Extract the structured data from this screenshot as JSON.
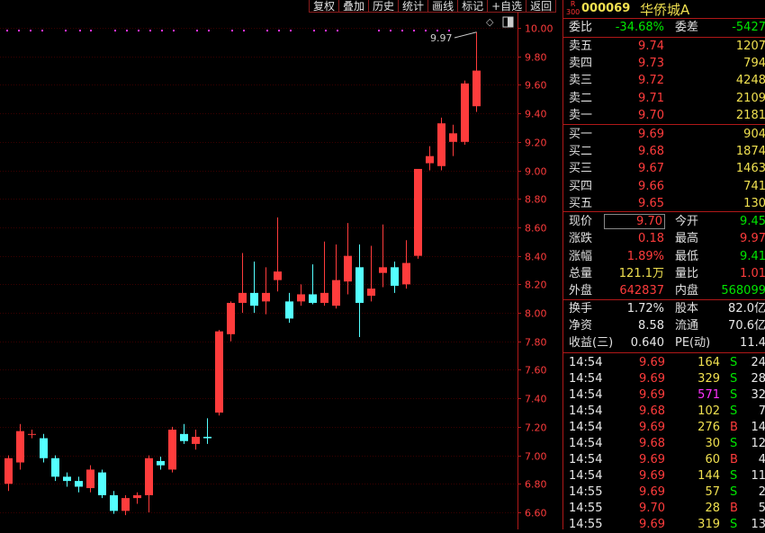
{
  "toolbar": [
    "复权",
    "叠加",
    "历史",
    "统计",
    "画线",
    "标记",
    "+自选",
    "返回"
  ],
  "header": {
    "badge_top": "R",
    "badge_bottom": "300",
    "code": "000069",
    "name": "华侨城A"
  },
  "ratio": {
    "label1": "委比",
    "value1": "-34.68%",
    "label2": "委差",
    "value2": "-5427"
  },
  "asks": [
    {
      "label": "卖五",
      "price": "9.74",
      "vol": "1207"
    },
    {
      "label": "卖四",
      "price": "9.73",
      "vol": "794"
    },
    {
      "label": "卖三",
      "price": "9.72",
      "vol": "4248"
    },
    {
      "label": "卖二",
      "price": "9.71",
      "vol": "2109"
    },
    {
      "label": "卖一",
      "price": "9.70",
      "vol": "2181"
    }
  ],
  "bids": [
    {
      "label": "买一",
      "price": "9.69",
      "vol": "904"
    },
    {
      "label": "买二",
      "price": "9.68",
      "vol": "1874"
    },
    {
      "label": "买三",
      "price": "9.67",
      "vol": "1463"
    },
    {
      "label": "买四",
      "price": "9.66",
      "vol": "741"
    },
    {
      "label": "买五",
      "price": "9.65",
      "vol": "130"
    }
  ],
  "quote": [
    {
      "l": "现价",
      "v": "9.70",
      "l2": "今开",
      "v2": "9.45"
    },
    {
      "l": "涨跌",
      "v": "0.18",
      "l2": "最高",
      "v2": "9.97"
    },
    {
      "l": "涨幅",
      "v": "1.89%",
      "l2": "最低",
      "v2": "9.41"
    },
    {
      "l": "总量",
      "v": "121.1万",
      "l2": "量比",
      "v2": "1.01"
    },
    {
      "l": "外盘",
      "v": "642837",
      "l2": "内盘",
      "v2": "568099"
    }
  ],
  "stats": [
    {
      "l": "换手",
      "v": "1.72%",
      "l2": "股本",
      "v2": "82.0亿"
    },
    {
      "l": "净资",
      "v": "8.58",
      "l2": "流通",
      "v2": "70.6亿"
    },
    {
      "l": "收益(三)",
      "v": "0.640",
      "l2": "PE(动)",
      "v2": "11.4"
    }
  ],
  "ticks": [
    {
      "time": "14:54",
      "price": "9.69",
      "vol": "164",
      "side": "S",
      "num": "24"
    },
    {
      "time": "14:54",
      "price": "9.69",
      "vol": "329",
      "side": "S",
      "num": "28"
    },
    {
      "time": "14:54",
      "price": "9.69",
      "vol": "571",
      "side": "S",
      "num": "32"
    },
    {
      "time": "14:54",
      "price": "9.68",
      "vol": "102",
      "side": "S",
      "num": "7"
    },
    {
      "time": "14:54",
      "price": "9.69",
      "vol": "276",
      "side": "B",
      "num": "14"
    },
    {
      "time": "14:54",
      "price": "9.68",
      "vol": "30",
      "side": "S",
      "num": "12"
    },
    {
      "time": "14:54",
      "price": "9.69",
      "vol": "60",
      "side": "B",
      "num": "4"
    },
    {
      "time": "14:54",
      "price": "9.69",
      "vol": "144",
      "side": "S",
      "num": "11"
    },
    {
      "time": "14:55",
      "price": "9.69",
      "vol": "57",
      "side": "S",
      "num": "2"
    },
    {
      "time": "14:55",
      "price": "9.70",
      "vol": "28",
      "side": "B",
      "num": "5"
    },
    {
      "time": "14:55",
      "price": "9.69",
      "vol": "319",
      "side": "S",
      "num": "13"
    }
  ],
  "chart_data": {
    "type": "candlestick",
    "ylim": [
      6.53,
      10.09
    ],
    "y_ticks": [
      "10.00",
      "9.80",
      "9.60",
      "9.40",
      "9.20",
      "9.00",
      "8.80",
      "8.60",
      "8.40",
      "8.20",
      "8.00",
      "7.80",
      "7.60",
      "7.40",
      "7.20",
      "7.00",
      "6.80",
      "6.60"
    ],
    "high_annotation": "9.97",
    "candles": [
      {
        "o": 6.8,
        "h": 7.0,
        "l": 6.75,
        "c": 6.98
      },
      {
        "o": 6.95,
        "h": 7.22,
        "l": 6.9,
        "c": 7.17
      },
      {
        "o": 7.15,
        "h": 7.18,
        "l": 7.12,
        "c": 7.15
      },
      {
        "o": 7.12,
        "h": 7.15,
        "l": 6.95,
        "c": 6.98
      },
      {
        "o": 6.98,
        "h": 7.0,
        "l": 6.82,
        "c": 6.85
      },
      {
        "o": 6.85,
        "h": 6.88,
        "l": 6.78,
        "c": 6.82
      },
      {
        "o": 6.82,
        "h": 6.85,
        "l": 6.74,
        "c": 6.78
      },
      {
        "o": 6.77,
        "h": 6.93,
        "l": 6.74,
        "c": 6.9
      },
      {
        "o": 6.88,
        "h": 6.9,
        "l": 6.7,
        "c": 6.72
      },
      {
        "o": 6.72,
        "h": 6.75,
        "l": 6.59,
        "c": 6.61
      },
      {
        "o": 6.61,
        "h": 6.72,
        "l": 6.58,
        "c": 6.7
      },
      {
        "o": 6.7,
        "h": 6.74,
        "l": 6.66,
        "c": 6.72
      },
      {
        "o": 6.72,
        "h": 7.0,
        "l": 6.6,
        "c": 6.98
      },
      {
        "o": 6.96,
        "h": 6.99,
        "l": 6.9,
        "c": 6.93
      },
      {
        "o": 6.9,
        "h": 7.2,
        "l": 6.88,
        "c": 7.18
      },
      {
        "o": 7.15,
        "h": 7.22,
        "l": 7.08,
        "c": 7.1
      },
      {
        "o": 7.08,
        "h": 7.18,
        "l": 7.04,
        "c": 7.13
      },
      {
        "o": 7.13,
        "h": 7.26,
        "l": 7.08,
        "c": 7.12
      },
      {
        "o": 7.3,
        "h": 7.88,
        "l": 7.28,
        "c": 7.87
      },
      {
        "o": 7.85,
        "h": 8.08,
        "l": 7.8,
        "c": 8.07
      },
      {
        "o": 8.07,
        "h": 8.42,
        "l": 8.0,
        "c": 8.14
      },
      {
        "o": 8.14,
        "h": 8.36,
        "l": 8.0,
        "c": 8.05
      },
      {
        "o": 8.08,
        "h": 8.32,
        "l": 7.99,
        "c": 8.14
      },
      {
        "o": 8.23,
        "h": 8.67,
        "l": 8.15,
        "c": 8.29
      },
      {
        "o": 8.08,
        "h": 8.14,
        "l": 7.93,
        "c": 7.96
      },
      {
        "o": 8.08,
        "h": 8.2,
        "l": 8.05,
        "c": 8.13
      },
      {
        "o": 8.13,
        "h": 8.34,
        "l": 8.06,
        "c": 8.07
      },
      {
        "o": 8.07,
        "h": 8.5,
        "l": 8.05,
        "c": 8.14
      },
      {
        "o": 8.05,
        "h": 8.48,
        "l": 8.03,
        "c": 8.23
      },
      {
        "o": 8.22,
        "h": 8.63,
        "l": 8.13,
        "c": 8.4
      },
      {
        "o": 8.32,
        "h": 8.48,
        "l": 7.83,
        "c": 8.07
      },
      {
        "o": 8.12,
        "h": 8.47,
        "l": 8.08,
        "c": 8.17
      },
      {
        "o": 8.28,
        "h": 8.62,
        "l": 8.18,
        "c": 8.32
      },
      {
        "o": 8.32,
        "h": 8.36,
        "l": 8.14,
        "c": 8.19
      },
      {
        "o": 8.2,
        "h": 8.51,
        "l": 8.17,
        "c": 8.35
      },
      {
        "o": 8.4,
        "h": 8.98,
        "l": 8.38,
        "c": 9.01
      },
      {
        "o": 9.05,
        "h": 9.17,
        "l": 9.0,
        "c": 9.1
      },
      {
        "o": 9.03,
        "h": 9.37,
        "l": 9.0,
        "c": 9.33
      },
      {
        "o": 9.2,
        "h": 9.32,
        "l": 9.1,
        "c": 9.26
      },
      {
        "o": 9.2,
        "h": 9.63,
        "l": 9.18,
        "c": 9.61
      },
      {
        "o": 9.45,
        "h": 9.97,
        "l": 9.41,
        "c": 9.7
      }
    ]
  }
}
